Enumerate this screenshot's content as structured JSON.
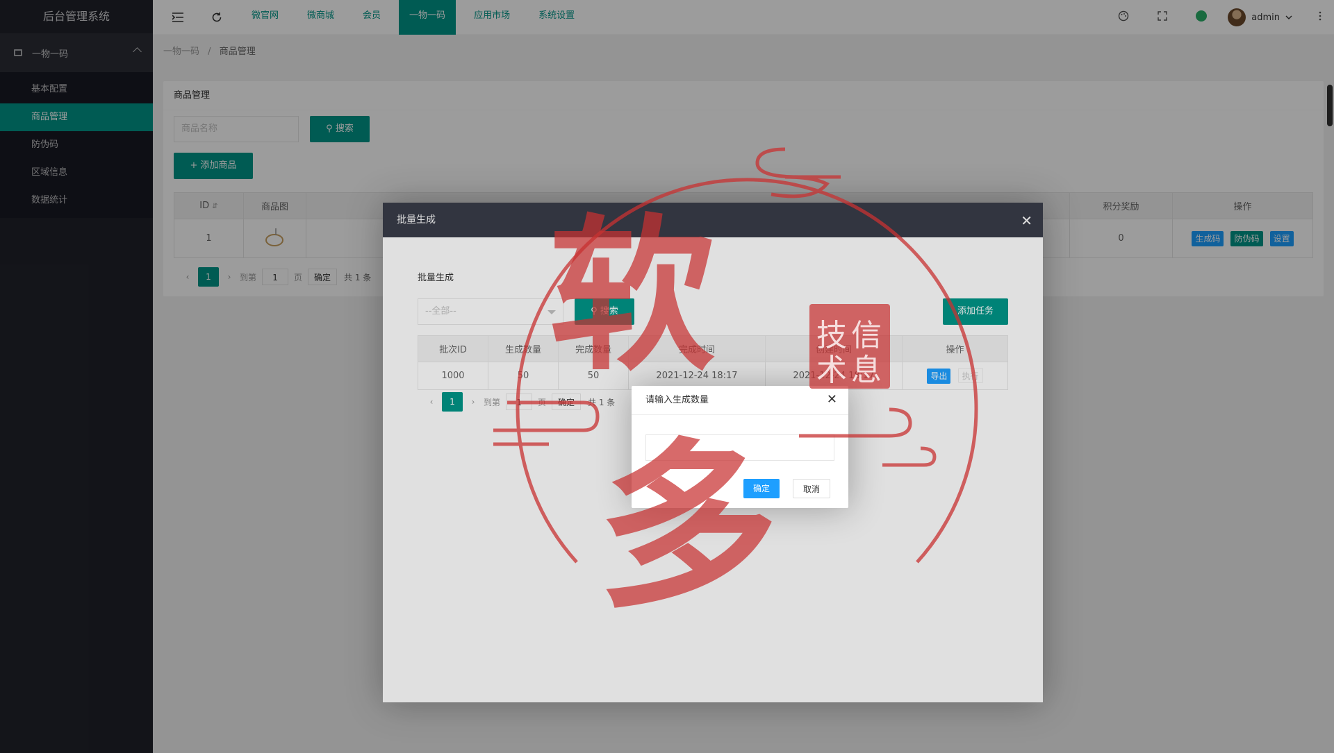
{
  "sidebar": {
    "app_title": "后台管理系统",
    "group_label": "一物一码",
    "items": [
      {
        "label": "基本配置"
      },
      {
        "label": "商品管理",
        "active": true
      },
      {
        "label": "防伪码"
      },
      {
        "label": "区域信息"
      },
      {
        "label": "数据统计"
      }
    ]
  },
  "header": {
    "nav": [
      "微官网",
      "微商城",
      "会员",
      "一物一码",
      "应用市场",
      "系统设置"
    ],
    "active_nav": "一物一码",
    "username": "admin"
  },
  "breadcrumb": {
    "parent": "一物一码",
    "separator": "/",
    "current": "商品管理"
  },
  "product_card": {
    "title": "商品管理",
    "search_placeholder": "商品名称",
    "search_button": "搜索",
    "add_button": "添加商品",
    "columns": {
      "id": "ID",
      "image": "商品图",
      "points": "积分奖励",
      "actions": "操作"
    },
    "row": {
      "id": "1",
      "points": "0",
      "btn_generate": "生成码",
      "btn_anticounterfeit": "防伪码",
      "btn_settings": "设置"
    },
    "pager": {
      "current": "1",
      "goto_label": "到第",
      "goto_value": "1",
      "page_unit": "页",
      "confirm": "确定",
      "total": "共 1 条"
    }
  },
  "batch_modal": {
    "title": "批量生成",
    "section_title": "批量生成",
    "select_placeholder": "--全部--",
    "search_button": "搜索",
    "add_task_button": "添加任务",
    "columns": [
      "批次ID",
      "生成数量",
      "完成数量",
      "完成时间",
      "创建时间",
      "操作"
    ],
    "row": {
      "batch_id": "1000",
      "generated": "50",
      "completed": "50",
      "finish_time": "2021-12-24 18:17",
      "create_time": "2021-12-24 18:17",
      "btn_export": "导出",
      "btn_execute": "执行"
    },
    "pager": {
      "current": "1",
      "goto_label": "到第",
      "goto_value": "1",
      "page_unit": "页",
      "confirm": "确定",
      "total": "共 1 条"
    }
  },
  "prompt": {
    "title": "请输入生成数量",
    "input_value": "",
    "ok_button": "确定",
    "cancel_button": "取消"
  },
  "watermark": {
    "main_chars": [
      "软",
      "多"
    ],
    "seal_chars": [
      "技",
      "信",
      "术",
      "息"
    ],
    "color": "#c83232"
  }
}
